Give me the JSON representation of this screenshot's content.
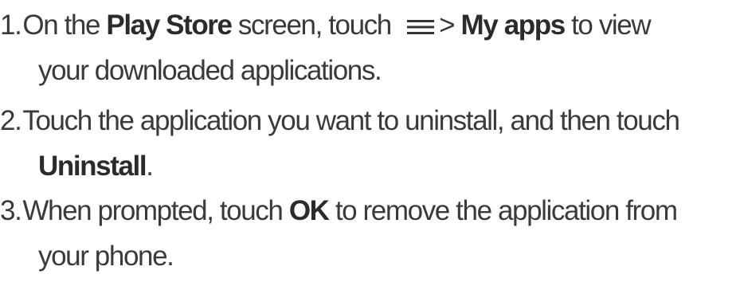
{
  "steps": [
    {
      "number": "1.",
      "text_a": "On the ",
      "bold_a": "Play Store",
      "text_b": " screen, touch ",
      "icon": "menu-icon",
      "text_c": "> ",
      "bold_b": "My apps",
      "text_d": " to view",
      "line2": "your downloaded applications."
    },
    {
      "number": "2.",
      "text_a": "Touch the application you want to uninstall, and then touch",
      "bold_a": "Uninstall",
      "text_b": "."
    },
    {
      "number": "3.",
      "text_a": "When prompted, touch ",
      "bold_a": "OK",
      "text_b": " to remove the application from",
      "line2": "your phone."
    }
  ],
  "colors": {
    "text": "#3a3a3a"
  }
}
